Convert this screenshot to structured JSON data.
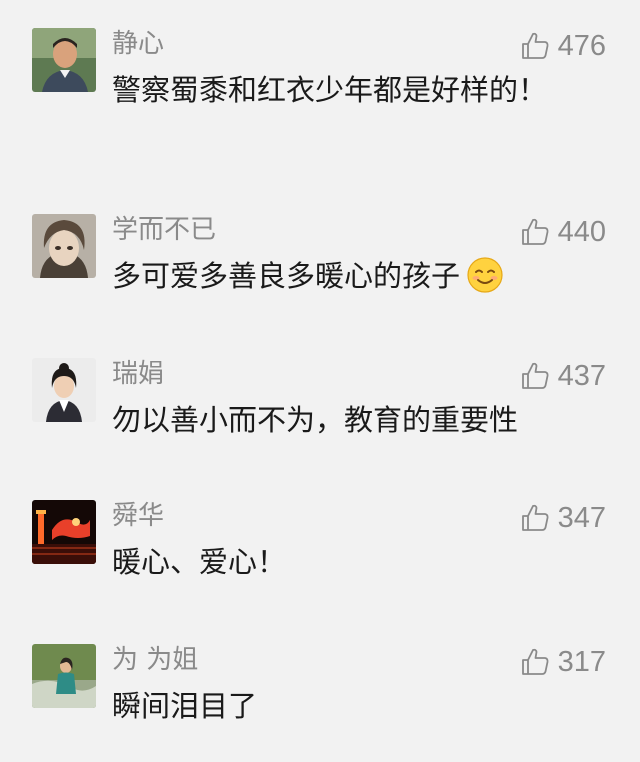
{
  "comments": [
    {
      "name": "静心",
      "likes": "476",
      "text": "警察蜀黍和红衣少年都是好样的！",
      "avatar": "man-portrait-avatar"
    },
    {
      "name": "学而不已",
      "likes": "440",
      "text": "多可爱多善良多暖心的孩子",
      "emoji": "smiling-face-emoji",
      "avatar": "anime-boy-avatar"
    },
    {
      "name": "瑞娟",
      "likes": "437",
      "text": "勿以善小而不为，教育的重要性",
      "avatar": "woman-portrait-avatar"
    },
    {
      "name": "舜华",
      "likes": "347",
      "text": "暖心、爱心！",
      "avatar": "night-lanterns-avatar"
    },
    {
      "name": "为 为姐",
      "likes": "317",
      "text": "瞬间泪目了",
      "avatar": "outdoor-woman-avatar"
    }
  ],
  "colors": {
    "background": "#f2f2f2",
    "name": "#8a8a8a",
    "text": "#1a1a1a",
    "like_icon": "#8a8a8a"
  }
}
